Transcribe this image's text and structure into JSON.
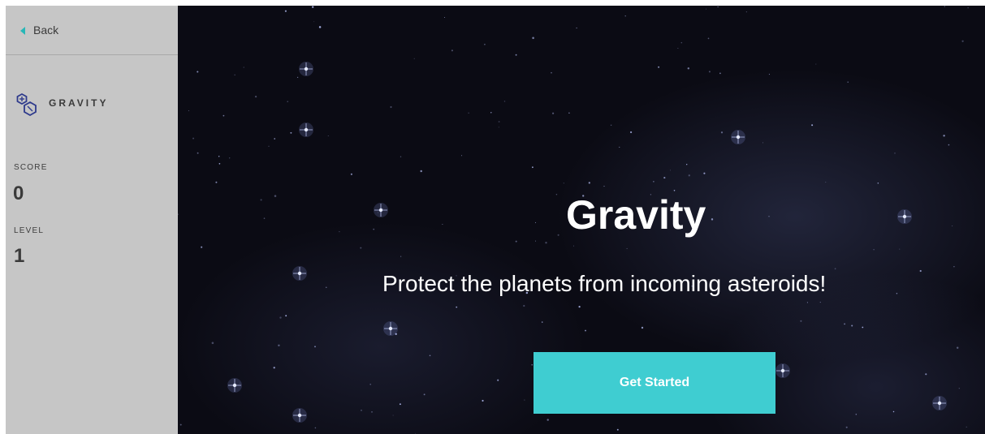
{
  "sidebar": {
    "back_label": "Back",
    "logo_text": "GRAVITY",
    "score_label": "SCORE",
    "score_value": "0",
    "level_label": "LEVEL",
    "level_value": "1"
  },
  "game": {
    "title": "Gravity",
    "subtitle": "Protect the planets from incoming asteroids!",
    "start_button_label": "Get Started"
  },
  "colors": {
    "sidebar_bg": "#c6c6c6",
    "accent": "#3fcdd1",
    "back_arrow": "#27b7b7",
    "logo_outline": "#2e3a8c",
    "space_bg": "#0b0b14"
  },
  "icons": {
    "back": "back-arrow-icon",
    "logo": "gravity-logo-icon"
  }
}
